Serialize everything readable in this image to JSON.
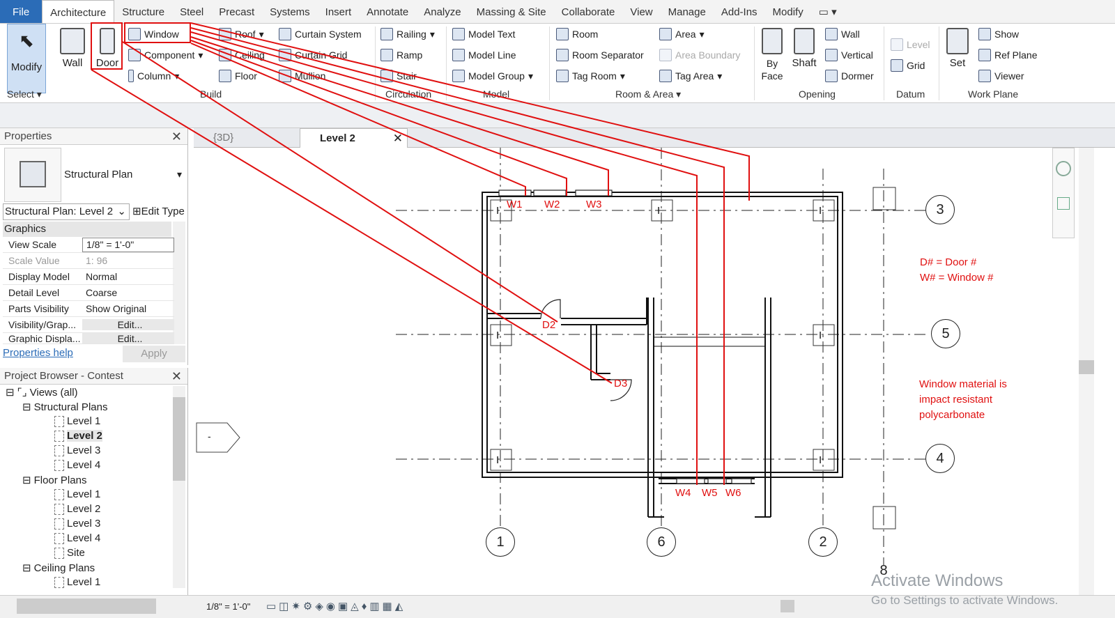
{
  "menu": [
    "File",
    "Architecture",
    "Structure",
    "Steel",
    "Precast",
    "Systems",
    "Insert",
    "Annotate",
    "Analyze",
    "Massing & Site",
    "Collaborate",
    "View",
    "Manage",
    "Add-Ins",
    "Modify"
  ],
  "ribbon": {
    "modify": "Modify",
    "select": "Select",
    "wall": "Wall",
    "door": "Door",
    "window": "Window",
    "component": "Component",
    "column": "Column",
    "roof": "Roof",
    "ceiling": "Ceiling",
    "floor": "Floor",
    "curtain_system": "Curtain System",
    "curtain_grid": "Curtain Grid",
    "mullion": "Mullion",
    "build": "Build",
    "railing": "Railing",
    "ramp": "Ramp",
    "stair": "Stair",
    "circulation": "Circulation",
    "model_text": "Model Text",
    "model_line": "Model Line",
    "model_group": "Model Group",
    "model": "Model",
    "room": "Room",
    "room_separator": "Room Separator",
    "tag_room": "Tag Room",
    "area": "Area",
    "area_boundary": "Area Boundary",
    "tag_area": "Tag Area",
    "room_area": "Room & Area",
    "by_face": "By Face",
    "shaft": "Shaft",
    "wall2": "Wall",
    "vertical": "Vertical",
    "dormer": "Dormer",
    "opening": "Opening",
    "level": "Level",
    "grid": "Grid",
    "datum": "Datum",
    "set": "Set",
    "show": "Show",
    "ref_plane": "Ref Plane",
    "viewer": "Viewer",
    "work_plane": "Work Plane"
  },
  "properties": {
    "title": "Properties",
    "type": "Structural Plan",
    "selector": "Structural Plan: Level 2",
    "edit_type": "Edit Type",
    "section": "Graphics",
    "rows": [
      {
        "k": "View Scale",
        "v": "1/8\" = 1'-0\""
      },
      {
        "k": "Scale Value",
        "v": "1: 96"
      },
      {
        "k": "Display Model",
        "v": "Normal"
      },
      {
        "k": "Detail Level",
        "v": "Coarse"
      },
      {
        "k": "Parts Visibility",
        "v": "Show Original"
      },
      {
        "k": "Visibility/Grap...",
        "v": "Edit..."
      },
      {
        "k": "Graphic Displa...",
        "v": "Edit..."
      }
    ],
    "help": "Properties help",
    "apply": "Apply"
  },
  "browser": {
    "title": "Project Browser - Contest",
    "views": "Views (all)",
    "structural": "Structural Plans",
    "floor": "Floor Plans",
    "ceiling": "Ceiling Plans",
    "s_levels": [
      "Level 1",
      "Level 2",
      "Level 3",
      "Level 4"
    ],
    "f_levels": [
      "Level 1",
      "Level 2",
      "Level 3",
      "Level 4",
      "Site"
    ],
    "c_levels": [
      "Level 1"
    ]
  },
  "view_tabs": [
    "{3D}",
    "Level 2"
  ],
  "annot": {
    "windows": [
      "W1",
      "W2",
      "W3",
      "W4",
      "W5",
      "W6"
    ],
    "doors": [
      "D2",
      "D3"
    ],
    "legend": [
      "D# = Door #",
      "W# = Window #"
    ],
    "material": [
      "Window material is",
      "impact resistant",
      "polycarbonate"
    ]
  },
  "grid_bubbles": [
    "3",
    "5",
    "4",
    "1",
    "6",
    "2",
    "8"
  ],
  "section_marker": "-",
  "status_scale": "1/8\" = 1'-0\"",
  "watermark": {
    "title": "Activate Windows",
    "sub": "Go to Settings to activate Windows."
  },
  "colors": {
    "accent": "#2b6cb7",
    "annotation": "#e01010"
  }
}
